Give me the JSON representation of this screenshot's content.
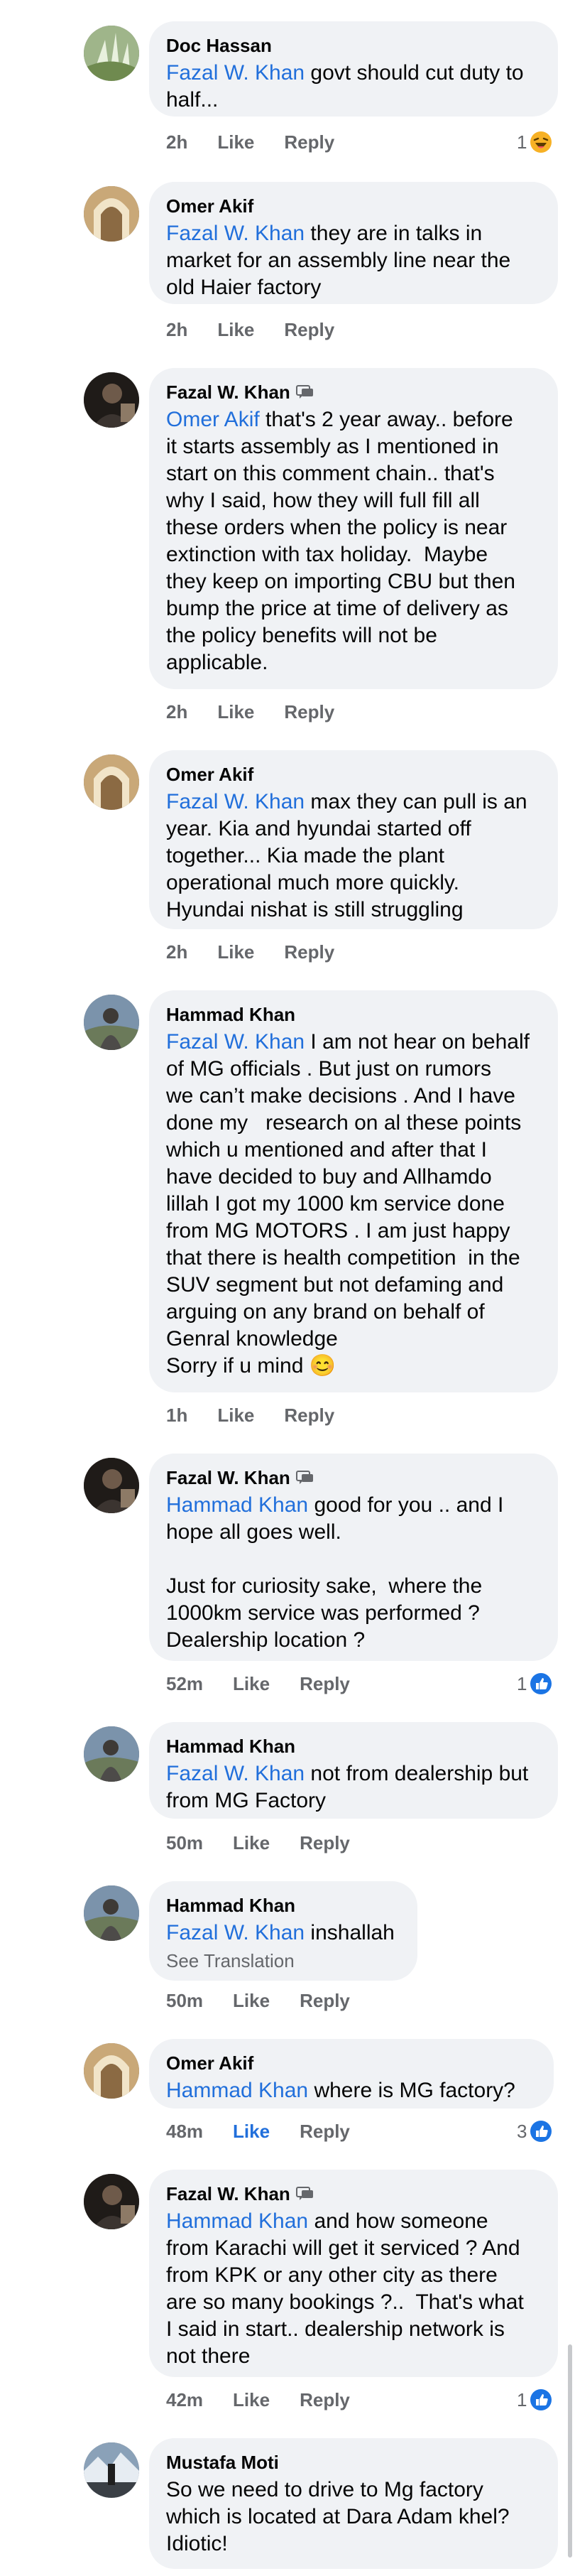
{
  "colors": {
    "mention": "#216fdb",
    "bubble": "#f0f2f5",
    "meta": "#65676b",
    "like_active": "#216fdb"
  },
  "actions": {
    "like": "Like",
    "reply": "Reply"
  },
  "comments": [
    {
      "author": "Doc Hassan",
      "mention": "Fazal W. Khan",
      "text": " govt should cut duty to\nhalf...",
      "time": "2h",
      "reaction_count": "1",
      "reaction_icon": "haha-icon"
    },
    {
      "author": "Omer Akif",
      "mention": "Fazal W. Khan",
      "text": " they are in talks in\nmarket for an assembly line near the\nold Haier factory",
      "time": "2h"
    },
    {
      "author": "Fazal W. Khan",
      "badge": "author-badge-icon",
      "mention": "Omer Akif",
      "text": " that's 2 year away.. before\nit starts assembly as I mentioned in\nstart on this comment chain.. that's\nwhy I said, how they will full fill all\nthese orders when the policy is near\nextinction with tax holiday.  Maybe\nthey keep on importing CBU but then\nbump the price at time of delivery as\nthe policy benefits will not be\napplicable.",
      "time": "2h"
    },
    {
      "author": "Omer Akif",
      "mention": "Fazal W. Khan",
      "text": " max they can pull is an\nyear. Kia and hyundai started off\ntogether... Kia made the plant\noperational much more quickly.\nHyundai nishat is still struggling",
      "time": "2h"
    },
    {
      "author": "Hammad Khan",
      "mention": "Fazal W. Khan",
      "text": " I am not hear on behalf\nof MG officials . But just on rumors\nwe can’t make decisions . And I have\ndone my   research on al these points\nwhich u mentioned and after that I\nhave decided to buy and Allhamdo\nlillah I got my 1000 km service done\nfrom MG MOTORS . I am just happy\nthat there is health competition  in the\nSUV segment but not defaming and\narguing on any brand on behalf of\nGenral knowledge\nSorry if u mind 😊",
      "time": "1h"
    },
    {
      "author": "Fazal W. Khan",
      "badge": "author-badge-icon",
      "mention": "Hammad Khan",
      "text": " good for you .. and I\nhope all goes well.\n\nJust for curiosity sake,  where the\n1000km service was performed ?\nDealership location ?",
      "time": "52m",
      "reaction_count": "1",
      "reaction_icon": "like-icon"
    },
    {
      "author": "Hammad Khan",
      "mention": "Fazal W. Khan",
      "text": " not from dealership but\nfrom MG Factory",
      "time": "50m"
    },
    {
      "author": "Hammad Khan",
      "mention": "Fazal W. Khan",
      "text": " inshallah",
      "see_translation": "See Translation",
      "time": "50m"
    },
    {
      "author": "Omer Akif",
      "mention": "Hammad Khan",
      "text": " where is MG factory?",
      "time": "48m",
      "liked": true,
      "reaction_count": "3",
      "reaction_icon": "like-icon"
    },
    {
      "author": "Fazal W. Khan",
      "badge": "author-badge-icon",
      "mention": "Hammad Khan",
      "text": " and how someone\nfrom Karachi will get it serviced ? And\nfrom KPK or any other city as there\nare so many bookings ?..  That's what\nI said in start.. dealership network is\nnot there",
      "time": "42m",
      "reaction_count": "1",
      "reaction_icon": "like-icon"
    },
    {
      "author": "Mustafa Moti",
      "text": "So we need to drive to Mg factory\nwhich is located at Dara Adam khel?\nIdiotic!"
    }
  ]
}
